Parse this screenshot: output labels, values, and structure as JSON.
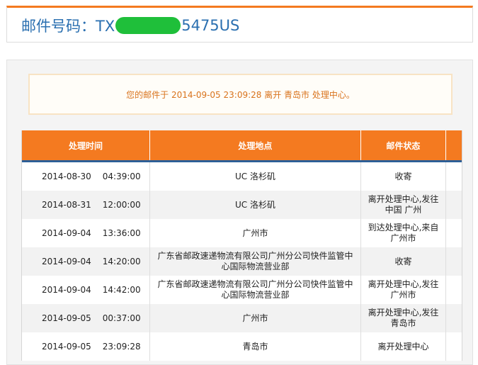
{
  "header": {
    "title_prefix": "邮件号码：TX",
    "title_suffix": "5475US"
  },
  "notice": {
    "text": "您的邮件于 2014-09-05 23:09:28 离开 青岛市 处理中心。"
  },
  "table": {
    "columns": [
      "处理时间",
      "处理地点",
      "邮件状态"
    ],
    "rows": [
      {
        "date": "2014-08-30",
        "time": "04:39:00",
        "location": "UC 洛杉矶",
        "status": "收寄"
      },
      {
        "date": "2014-08-31",
        "time": "12:00:00",
        "location": "UC 洛杉矶",
        "status": "离开处理中心,发往中国 广州"
      },
      {
        "date": "2014-09-04",
        "time": "13:36:00",
        "location": "广州市",
        "status": "到达处理中心,来自广州市"
      },
      {
        "date": "2014-09-04",
        "time": "14:20:00",
        "location": "广东省邮政速递物流有限公司广州分公司快件监管中心国际物流营业部",
        "status": "收寄"
      },
      {
        "date": "2014-09-04",
        "time": "14:42:00",
        "location": "广东省邮政速递物流有限公司广州分公司快件监管中心国际物流营业部",
        "status": "离开处理中心,发往广州市"
      },
      {
        "date": "2014-09-05",
        "time": "00:37:00",
        "location": "广州市",
        "status": "离开处理中心,发往青岛市"
      },
      {
        "date": "2014-09-05",
        "time": "23:09:28",
        "location": "青岛市",
        "status": "离开处理中心"
      }
    ]
  },
  "colors": {
    "accent": "#f47a20",
    "title_blue": "#2a6fb0",
    "header_underline": "#2d5f97",
    "redaction_mask": "#1fbf3a"
  }
}
